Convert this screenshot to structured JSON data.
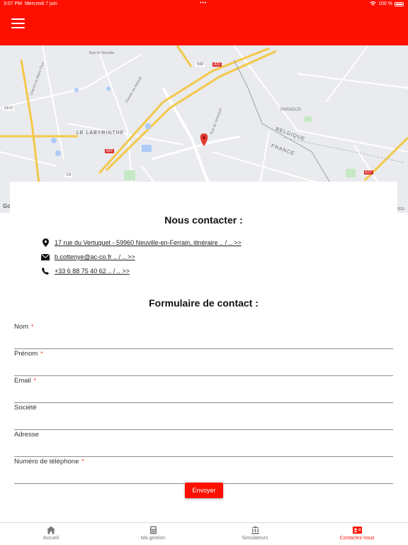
{
  "status_bar": {
    "time": "3:07 PM",
    "date": "Mercredi 7 juin",
    "battery": "100 %",
    "dots": "•••"
  },
  "header": {
    "menu_icon": "hamburger-icon",
    "background": "#fe1000"
  },
  "map": {
    "places": [
      "LE LABYRINTHE",
      "PARADIJS",
      "BELGIQUE",
      "FRANCE",
      "Chemin du Blanc Four",
      "Rue du Vertuquet",
      "Rue de Neuville",
      "Chemin du Hérault"
    ],
    "road_labels": [
      "A22",
      "A22",
      "N58",
      "D670",
      "D9",
      "E17"
    ],
    "attribution": "Google",
    "copyright": "©2023",
    "marker_icon": "map-pin-icon"
  },
  "contact": {
    "title": "Nous contacter :",
    "address": "17 rue du Vertuquet - 59960 Neuville-en-Ferrain, itinéraire .. / .. >>",
    "email": "b.cottenye@ac-co.fr .. / .. >>",
    "phone": "+33 6 88 75 40 62  .. / .. >>",
    "icons": [
      "location-pin-icon",
      "envelope-icon",
      "phone-icon"
    ]
  },
  "form": {
    "title": "Formulaire de contact :",
    "required_mark": "*",
    "fields": {
      "nom": "Nom",
      "prenom": "Prénom",
      "email": "Email",
      "societe": "Société",
      "adresse": "Adresse",
      "telephone": "Numéro de téléphone"
    },
    "submit": "Envoyer"
  },
  "tabs": [
    {
      "label": "Accueil",
      "icon": "home-icon"
    },
    {
      "label": "Ma gestion",
      "icon": "calculator-icon"
    },
    {
      "label": "Simulateurs",
      "icon": "bank-icon"
    },
    {
      "label": "Contactez-nous",
      "icon": "contact-card-icon",
      "active": true
    }
  ],
  "colors": {
    "accent": "#fe1000",
    "map_bg": "#e9ebee",
    "motorway": "#f3c84a"
  }
}
